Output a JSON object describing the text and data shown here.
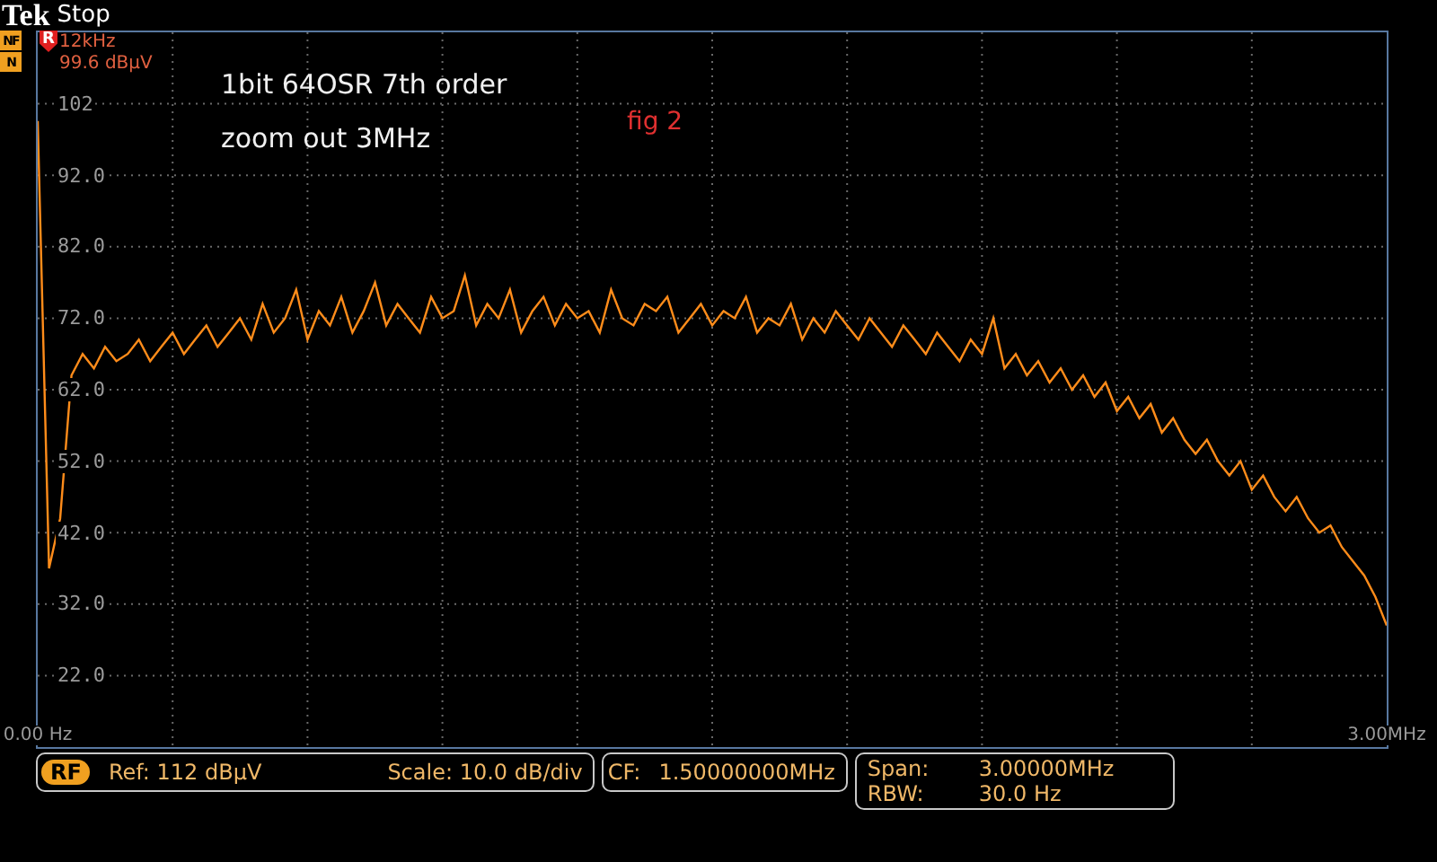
{
  "header": {
    "brand": "Tek",
    "state": "Stop"
  },
  "indicators": [
    "NF",
    "N"
  ],
  "marker": {
    "label": "R",
    "frequency": "12kHz",
    "amplitude": "99.6 dBµV"
  },
  "annotations": [
    {
      "kind": "note",
      "text": "1bit 64OSR 7th order"
    },
    {
      "kind": "note",
      "text": "zoom out 3MHz"
    },
    {
      "kind": "figure",
      "text": "fig 2"
    }
  ],
  "chart_data": {
    "type": "line",
    "xlim": [
      0,
      3
    ],
    "ylim": [
      12,
      112
    ],
    "grid": true,
    "xticks": [
      {
        "value": 0,
        "label": "0.00 Hz"
      },
      {
        "value": 3,
        "label": "3.00MHz"
      }
    ],
    "yticks": [
      {
        "value": 102,
        "label": "102"
      },
      {
        "value": 92,
        "label": "92.0"
      },
      {
        "value": 82,
        "label": "82.0"
      },
      {
        "value": 72,
        "label": "72.0"
      },
      {
        "value": 62,
        "label": "62.0"
      },
      {
        "value": 52,
        "label": "52.0"
      },
      {
        "value": 42,
        "label": "42.0"
      },
      {
        "value": 32,
        "label": "32.0"
      },
      {
        "value": 22,
        "label": "22.0"
      }
    ],
    "x": [
      0,
      0.025,
      0.05,
      0.075,
      0.1,
      0.125,
      0.15,
      0.175,
      0.2,
      0.225,
      0.25,
      0.275,
      0.3,
      0.325,
      0.35,
      0.375,
      0.4,
      0.425,
      0.45,
      0.475,
      0.5,
      0.525,
      0.55,
      0.575,
      0.6,
      0.625,
      0.65,
      0.675,
      0.7,
      0.725,
      0.75,
      0.775,
      0.8,
      0.825,
      0.85,
      0.875,
      0.9,
      0.925,
      0.95,
      0.975,
      1,
      1.025,
      1.05,
      1.075,
      1.1,
      1.125,
      1.15,
      1.175,
      1.2,
      1.225,
      1.25,
      1.275,
      1.3,
      1.325,
      1.35,
      1.375,
      1.4,
      1.425,
      1.45,
      1.475,
      1.5,
      1.525,
      1.55,
      1.575,
      1.6,
      1.625,
      1.65,
      1.675,
      1.7,
      1.725,
      1.75,
      1.775,
      1.8,
      1.825,
      1.85,
      1.875,
      1.9,
      1.925,
      1.95,
      1.975,
      2,
      2.025,
      2.05,
      2.075,
      2.1,
      2.125,
      2.15,
      2.175,
      2.2,
      2.225,
      2.25,
      2.275,
      2.3,
      2.325,
      2.35,
      2.375,
      2.4,
      2.425,
      2.45,
      2.475,
      2.5,
      2.525,
      2.55,
      2.575,
      2.6,
      2.625,
      2.65,
      2.675,
      2.7,
      2.725,
      2.75,
      2.775,
      2.8,
      2.825,
      2.85,
      2.875,
      2.9,
      2.925,
      2.95,
      2.975,
      3
    ],
    "series": [
      {
        "color": "#ff8c1a",
        "values": [
          99.6,
          37,
          44,
          64,
          67,
          65,
          68,
          66,
          67,
          69,
          66,
          68,
          70,
          67,
          69,
          71,
          68,
          70,
          72,
          69,
          74,
          70,
          72,
          76,
          69,
          73,
          71,
          75,
          70,
          73,
          77,
          71,
          74,
          72,
          70,
          75,
          72,
          73,
          78,
          71,
          74,
          72,
          76,
          70,
          73,
          75,
          71,
          74,
          72,
          73,
          70,
          76,
          72,
          71,
          74,
          73,
          75,
          70,
          72,
          74,
          71,
          73,
          72,
          75,
          70,
          72,
          71,
          74,
          69,
          72,
          70,
          73,
          71,
          69,
          72,
          70,
          68,
          71,
          69,
          67,
          70,
          68,
          66,
          69,
          67,
          72,
          65,
          67,
          64,
          66,
          63,
          65,
          62,
          64,
          61,
          63,
          59,
          61,
          58,
          60,
          56,
          58,
          55,
          53,
          55,
          52,
          50,
          52,
          48,
          50,
          47,
          45,
          47,
          44,
          42,
          43,
          40,
          38,
          36,
          33,
          29
        ]
      }
    ]
  },
  "status_bar": {
    "source": "RF",
    "ref": "Ref: 112 dBµV",
    "scale": "Scale: 10.0 dB/div",
    "cf_label": "CF:",
    "cf_value": "1.50000000MHz",
    "span_label": "Span:",
    "span_value": "3.00000MHz",
    "rbw_label": "RBW:",
    "rbw_value": "30.0 Hz"
  }
}
